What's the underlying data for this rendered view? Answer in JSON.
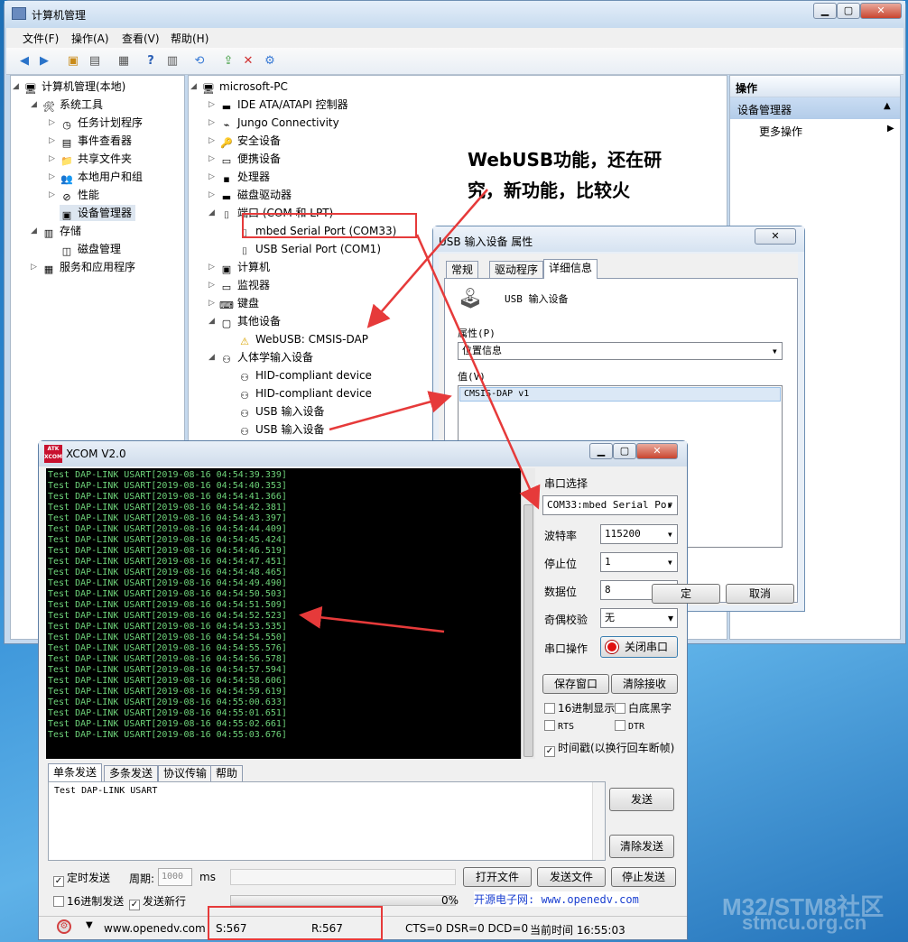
{
  "main_window": {
    "title": "计算机管理",
    "menu": [
      "文件(F)",
      "操作(A)",
      "查看(V)",
      "帮助(H)"
    ],
    "left_tree": [
      {
        "label": "计算机管理(本地)",
        "icon": "computer-manage-icon",
        "level": 0
      },
      {
        "label": "系统工具",
        "icon": "tools-icon",
        "level": 1
      },
      {
        "label": "任务计划程序",
        "icon": "clock-icon",
        "level": 2
      },
      {
        "label": "事件查看器",
        "icon": "event-icon",
        "level": 2
      },
      {
        "label": "共享文件夹",
        "icon": "folder-icon",
        "level": 2
      },
      {
        "label": "本地用户和组",
        "icon": "users-icon",
        "level": 2
      },
      {
        "label": "性能",
        "icon": "performance-icon",
        "level": 2
      },
      {
        "label": "设备管理器",
        "icon": "device-manager-icon",
        "level": 2
      },
      {
        "label": "存储",
        "icon": "storage-icon",
        "level": 1
      },
      {
        "label": "磁盘管理",
        "icon": "disk-icon",
        "level": 2
      },
      {
        "label": "服务和应用程序",
        "icon": "services-icon",
        "level": 1
      }
    ],
    "device_tree": [
      {
        "label": "microsoft-PC",
        "icon": "pc-icon",
        "level": 0
      },
      {
        "label": "IDE ATA/ATAPI 控制器",
        "icon": "ide-icon",
        "level": 1
      },
      {
        "label": "Jungo Connectivity",
        "icon": "usb-icon",
        "level": 1
      },
      {
        "label": "安全设备",
        "icon": "key-icon",
        "level": 1
      },
      {
        "label": "便携设备",
        "icon": "portable-icon",
        "level": 1
      },
      {
        "label": "处理器",
        "icon": "cpu-icon",
        "level": 1
      },
      {
        "label": "磁盘驱动器",
        "icon": "disk-drive-icon",
        "level": 1
      },
      {
        "label": "端口 (COM 和 LPT)",
        "icon": "port-icon",
        "level": 1
      },
      {
        "label": "mbed Serial Port (COM33)",
        "icon": "port-icon",
        "level": 2
      },
      {
        "label": "USB Serial Port (COM1)",
        "icon": "port-icon",
        "level": 2
      },
      {
        "label": "计算机",
        "icon": "computer-icon",
        "level": 1
      },
      {
        "label": "监视器",
        "icon": "monitor-icon",
        "level": 1
      },
      {
        "label": "键盘",
        "icon": "keyboard-icon",
        "level": 1
      },
      {
        "label": "其他设备",
        "icon": "other-device-icon",
        "level": 1
      },
      {
        "label": "WebUSB: CMSIS-DAP",
        "icon": "warning-device-icon",
        "level": 2
      },
      {
        "label": "人体学输入设备",
        "icon": "hid-icon",
        "level": 1
      },
      {
        "label": "HID-compliant device",
        "icon": "hid-icon",
        "level": 2
      },
      {
        "label": "HID-compliant device",
        "icon": "hid-icon",
        "level": 2
      },
      {
        "label": "USB 输入设备",
        "icon": "hid-icon",
        "level": 2
      },
      {
        "label": "USB 输入设备",
        "icon": "hid-icon",
        "level": 2
      }
    ],
    "actions": {
      "header": "操作",
      "section": "设备管理器",
      "more": "更多操作"
    }
  },
  "annotation": {
    "text_line1": "WebUSB功能，还在研",
    "text_line2": "究，新功能，比较火",
    "color": "#e63a3a"
  },
  "properties_dialog": {
    "title": "USB 输入设备 属性",
    "tabs": [
      "常规",
      "驱动程序",
      "详细信息"
    ],
    "device_name": "USB 输入设备",
    "property_label": "属性(P)",
    "property_value": "位置信息",
    "value_label": "值(V)",
    "value_item": "CMSIS-DAP v1",
    "ok_partial": "定",
    "cancel": "取消"
  },
  "xcom": {
    "title": "XCOM V2.0",
    "logo": "ATK XCOM",
    "log_lines": [
      "Test DAP-LINK USART[2019-08-16 04:54:39.339]",
      "Test DAP-LINK USART[2019-08-16 04:54:40.353]",
      "Test DAP-LINK USART[2019-08-16 04:54:41.366]",
      "Test DAP-LINK USART[2019-08-16 04:54:42.381]",
      "Test DAP-LINK USART[2019-08-16 04:54:43.397]",
      "Test DAP-LINK USART[2019-08-16 04:54:44.409]",
      "Test DAP-LINK USART[2019-08-16 04:54:45.424]",
      "Test DAP-LINK USART[2019-08-16 04:54:46.519]",
      "Test DAP-LINK USART[2019-08-16 04:54:47.451]",
      "Test DAP-LINK USART[2019-08-16 04:54:48.465]",
      "Test DAP-LINK USART[2019-08-16 04:54:49.490]",
      "Test DAP-LINK USART[2019-08-16 04:54:50.503]",
      "Test DAP-LINK USART[2019-08-16 04:54:51.509]",
      "Test DAP-LINK USART[2019-08-16 04:54:52.523]",
      "Test DAP-LINK USART[2019-08-16 04:54:53.535]",
      "Test DAP-LINK USART[2019-08-16 04:54:54.550]",
      "Test DAP-LINK USART[2019-08-16 04:54:55.576]",
      "Test DAP-LINK USART[2019-08-16 04:54:56.578]",
      "Test DAP-LINK USART[2019-08-16 04:54:57.594]",
      "Test DAP-LINK USART[2019-08-16 04:54:58.606]",
      "Test DAP-LINK USART[2019-08-16 04:54:59.619]",
      "Test DAP-LINK USART[2019-08-16 04:55:00.633]",
      "Test DAP-LINK USART[2019-08-16 04:55:01.651]",
      "Test DAP-LINK USART[2019-08-16 04:55:02.661]",
      "Test DAP-LINK USART[2019-08-16 04:55:03.676]"
    ],
    "port_label": "串口选择",
    "port_value": "COM33:mbed Serial Por",
    "baud_label": "波特率",
    "baud_value": "115200",
    "stop_label": "停止位",
    "stop_value": "1",
    "data_label": "数据位",
    "data_value": "8",
    "parity_label": "奇偶校验",
    "parity_value": "无",
    "op_label": "串口操作",
    "close_port": "关闭串口",
    "save_window": "保存窗口",
    "clear_recv": "清除接收",
    "hex_display": "16进制显示",
    "white_bg": "白底黑字",
    "rts": "RTS",
    "dtr": "DTR",
    "timestamp": "时间戳(以换行回车断帧)",
    "tabs": [
      "单条发送",
      "多条发送",
      "协议传输",
      "帮助"
    ],
    "send_text": "Test DAP-LINK USART",
    "send_btn": "发送",
    "clear_send": "清除发送",
    "timed_send": "定时发送",
    "period_label": "周期:",
    "period_value": "1000",
    "period_unit": "ms",
    "open_file": "打开文件",
    "send_file": "发送文件",
    "stop_send": "停止发送",
    "hex_send": "16进制发送",
    "send_newline": "发送新行",
    "progress": "0%",
    "website": "开源电子网: www.openedv.com",
    "status": {
      "url": "www.openedv.com",
      "s": "S:567",
      "r": "R:567",
      "lines": "CTS=0 DSR=0 DCD=0",
      "time": "当前时间 16:55:03"
    }
  },
  "watermark": {
    "line1": "M32/STM8社区",
    "line2": "stmcu.org.cn"
  }
}
